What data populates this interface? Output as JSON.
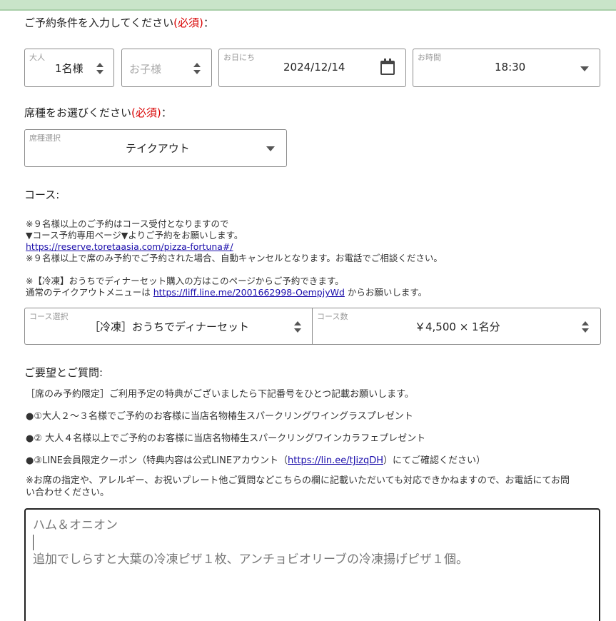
{
  "conditions": {
    "heading": "ご予約条件を入力してください",
    "required": "(必須)",
    "colon": "：",
    "adults": {
      "label": "大人",
      "value": "1名様"
    },
    "children": {
      "placeholder": "お子様"
    },
    "date": {
      "label": "お日にち",
      "value": "2024/12/14",
      "icon": "calendar-icon"
    },
    "time": {
      "label": "お時間",
      "value": "18:30"
    }
  },
  "seat": {
    "heading": "席種をお選びください",
    "required": "(必須)",
    "colon": "：",
    "label": "席種選択",
    "value": "テイクアウト"
  },
  "course": {
    "heading": "コース:",
    "notes": {
      "line1": "※９名様以上のご予約はコース受付となりますので",
      "line2": "▼コース予約専用ページ▼よりご予約をお願いします。",
      "link1": "https://reserve.toretaasia.com/pizza-fortuna#/",
      "line3": "※９名様以上で席のみ予約でご予約された場合、自動キャンセルとなります。お電話でご相談ください。",
      "line4": "※【冷凍】おうちでディナーセット購入の方はこのページからご予約できます。",
      "line5_prefix": "通常のテイクアウトメニューは",
      "link2": "https://liff.line.me/2001662998-OempjyWd",
      "line5_suffix": "からお願いします。"
    },
    "select_label": "コース選択",
    "select_value": "［冷凍］おうちでディナーセット",
    "count_label": "コース数",
    "count_value": "￥4,500 × 1名分"
  },
  "requests": {
    "heading": "ご要望とご質問:",
    "line1": "［席のみ予約限定］ご利用予定の特典がございましたら下記番号をひとつ記載お願いします。",
    "line2": "●①大人２～３名様でご予約のお客様に当店名物椿生スパークリングワイングラスプレゼント",
    "line3": "●② 大人４名様以上でご予約のお客様に当店名物椿生スパークリングワインカラフェプレゼント",
    "line4_prefix": "●③LINE会員限定クーポン（特典内容は公式LINEアカウント（",
    "line4_link": "https://lin.ee/tJizqDH",
    "line4_suffix": "）にてご確認ください）",
    "line5a": "※お席の指定や、アレルギー、お祝いプレート他ご質問などこちらの欄に記載いただいても対応できかねますので、お電話にてお問",
    "line5b": "い合わせください。",
    "text_line1": "ハム＆オニオン",
    "text_line3": "追加でしらすと大葉の冷凍ピザ１枚、アンチョビオリーブの冷凍揚げピザ１個。"
  }
}
